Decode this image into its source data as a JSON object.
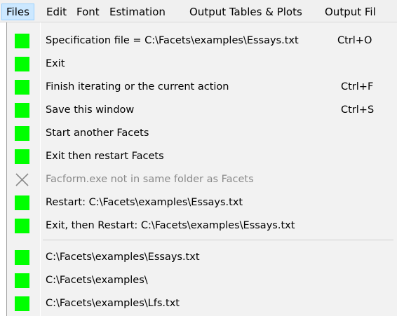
{
  "menubar": {
    "items": [
      "Files",
      "Edit",
      "Font",
      "Estimation",
      "Output Tables & Plots",
      "Output Fil"
    ]
  },
  "files_menu": {
    "items": [
      {
        "label": "Specification file = C:\\Facets\\examples\\Essays.txt",
        "shortcut": "Ctrl+O",
        "icon": "green-square-icon",
        "enabled": true
      },
      {
        "label": "Exit",
        "shortcut": "",
        "icon": "green-square-icon",
        "enabled": true
      },
      {
        "label": "Finish iterating or the current action",
        "shortcut": "Ctrl+F",
        "icon": "green-square-icon",
        "enabled": true
      },
      {
        "label": "Save this window",
        "shortcut": "Ctrl+S",
        "icon": "green-square-icon",
        "enabled": true
      },
      {
        "label": "Start another Facets",
        "shortcut": "",
        "icon": "green-square-icon",
        "enabled": true
      },
      {
        "label": "Exit then restart Facets",
        "shortcut": "",
        "icon": "green-square-icon",
        "enabled": true
      },
      {
        "label": "Facform.exe not in same folder as Facets",
        "shortcut": "",
        "icon": "x-icon",
        "enabled": false
      },
      {
        "label": "Restart: C:\\Facets\\examples\\Essays.txt",
        "shortcut": "",
        "icon": "green-square-icon",
        "enabled": true
      },
      {
        "label": "Exit, then Restart: C:\\Facets\\examples\\Essays.txt",
        "shortcut": "",
        "icon": "green-square-icon",
        "enabled": true
      }
    ],
    "recent_files": [
      {
        "label": "C:\\Facets\\examples\\Essays.txt",
        "icon": "green-square-icon"
      },
      {
        "label": "C:\\Facets\\examples\\",
        "icon": "green-square-icon"
      },
      {
        "label": "C:\\Facets\\examples\\Lfs.txt",
        "icon": "green-square-icon"
      }
    ]
  },
  "colors": {
    "icon_green": "#00ff00",
    "menu_background": "#f2f2f2",
    "active_menu_highlight": "#cce8ff",
    "disabled_text": "#8a8a8a"
  }
}
